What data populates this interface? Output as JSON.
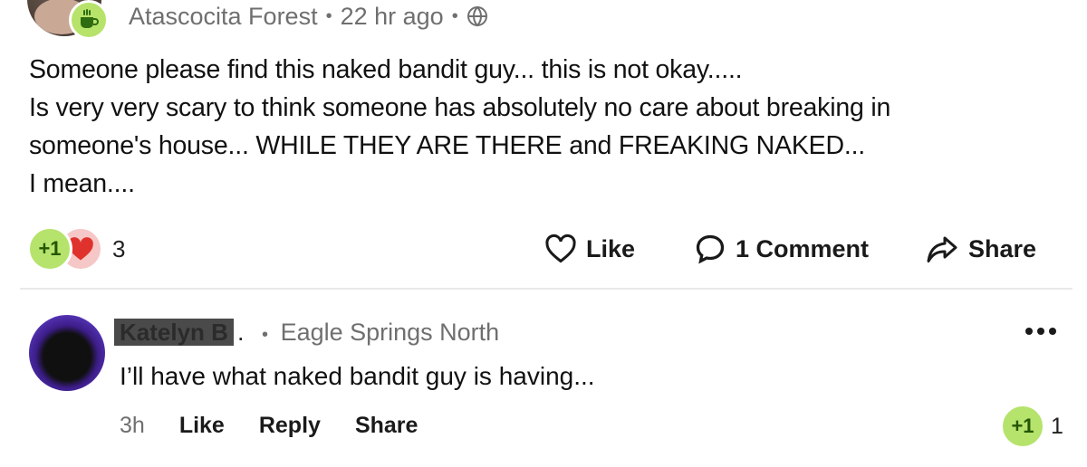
{
  "post": {
    "neighborhood": "Atascocita Forest",
    "time": "22 hr ago",
    "separator": "•",
    "body_lines": [
      "Someone please find this naked bandit guy... this is not okay.....",
      "Is very very scary to think someone has absolutely no care about breaking in",
      "someone's house... WHILE THEY ARE THERE and FREAKING NAKED...",
      "I mean...."
    ],
    "reactions": {
      "plus_label": "+1",
      "count": "3"
    },
    "actions": {
      "like": "Like",
      "comment": "1 Comment",
      "share": "Share"
    }
  },
  "comment": {
    "author": "Katelyn B",
    "author_suffix": ".",
    "separator": "•",
    "neighborhood": "Eagle Springs North",
    "text": "I’ll have what naked bandit guy is having...",
    "time": "3h",
    "actions": {
      "like": "Like",
      "reply": "Reply",
      "share": "Share"
    },
    "reaction": {
      "plus_label": "+1",
      "count": "1"
    }
  },
  "colors": {
    "accent_green": "#b5e36c",
    "heart_red": "#e0322c",
    "muted_text": "#6f6f6f"
  },
  "icons": [
    "coffee-badge-icon",
    "globe-icon",
    "heart-outline-icon",
    "comment-bubble-icon",
    "share-arrow-icon",
    "more-options-icon",
    "heart-icon"
  ]
}
